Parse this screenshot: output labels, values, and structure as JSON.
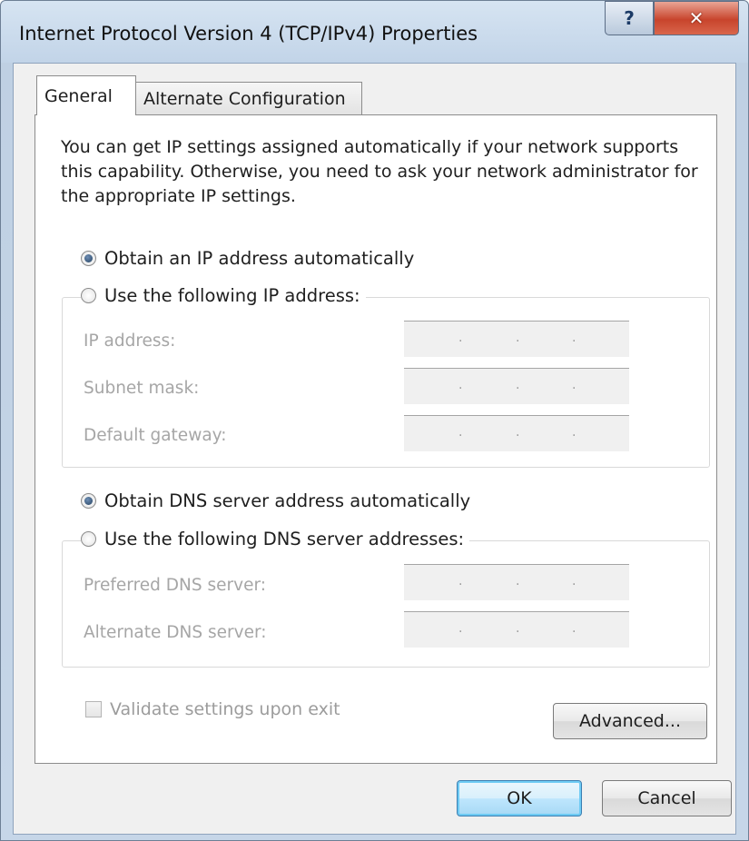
{
  "window": {
    "title": "Internet Protocol Version 4 (TCP/IPv4) Properties",
    "help_glyph": "?",
    "close_glyph": "✕"
  },
  "tabs": [
    {
      "label": "General",
      "selected": true
    },
    {
      "label": "Alternate Configuration",
      "selected": false
    }
  ],
  "general": {
    "description": "You can get IP settings assigned automatically if your network supports this capability. Otherwise, you need to ask your network administrator for the appropriate IP settings.",
    "ip_mode": {
      "auto_label": "Obtain an IP address automatically",
      "manual_label": "Use the following IP address:",
      "selected": "auto"
    },
    "ip_fields": [
      {
        "label": "IP address:",
        "value": ". . ."
      },
      {
        "label": "Subnet mask:",
        "value": ". . ."
      },
      {
        "label": "Default gateway:",
        "value": ". . ."
      }
    ],
    "dns_mode": {
      "auto_label": "Obtain DNS server address automatically",
      "manual_label": "Use the following DNS server addresses:",
      "selected": "auto"
    },
    "dns_fields": [
      {
        "label": "Preferred DNS server:",
        "value": ". . ."
      },
      {
        "label": "Alternate DNS server:",
        "value": ". . ."
      }
    ],
    "validate_label": "Validate settings upon exit",
    "validate_checked": false,
    "advanced_label": "Advanced..."
  },
  "footer": {
    "ok_label": "OK",
    "cancel_label": "Cancel"
  },
  "colors": {
    "disabled_text": "#a6a6a6",
    "ok_accent": "#6ecbf4",
    "close_red": "#c8442c"
  }
}
